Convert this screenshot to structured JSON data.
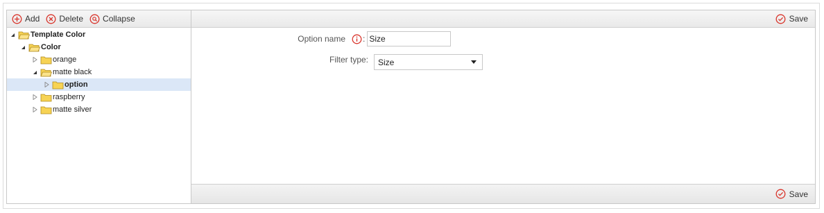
{
  "toolbar": {
    "add_label": "Add",
    "delete_label": "Delete",
    "collapse_label": "Collapse"
  },
  "tree": {
    "items": [
      {
        "label": "Template Color",
        "bold": true
      },
      {
        "label": "Color",
        "bold": true
      },
      {
        "label": "orange"
      },
      {
        "label": "matte black"
      },
      {
        "label": "option",
        "bold": true,
        "selected": true
      },
      {
        "label": "raspberry"
      },
      {
        "label": "matte silver"
      }
    ]
  },
  "form": {
    "save_label_top": "Save",
    "save_label_bottom": "Save",
    "option_name_label": "Option name",
    "option_name_colon": ":",
    "option_name_value": "Size",
    "filter_type_label": "Filter type:",
    "filter_type_value": "Size"
  },
  "colors": {
    "accent_red": "#d9342b",
    "selection": "#dbe7f7",
    "folder": "#f7d354"
  },
  "icons": {
    "add": "plus-circle-icon",
    "delete": "x-circle-icon",
    "collapse": "magnifier-circle-icon",
    "save": "check-circle-icon",
    "info": "info-circle-icon",
    "folder": "folder-icon"
  }
}
